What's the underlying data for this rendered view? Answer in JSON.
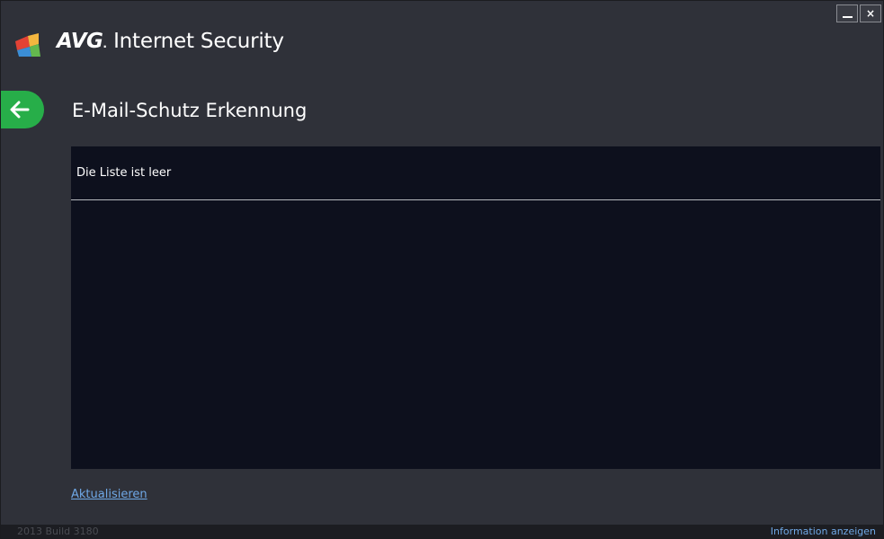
{
  "app": {
    "brand_bold": "AVG",
    "brand_dot": ".",
    "brand_rest": " Internet Security",
    "logo_colors": [
      "#e34235",
      "#f4b63f",
      "#3b8ed6",
      "#63b84e"
    ]
  },
  "window_controls": {
    "minimize_icon": "minimize-icon",
    "close_label": "×"
  },
  "header": {
    "back_icon": "arrow-left-icon",
    "title": "E-Mail-Schutz Erkennung"
  },
  "list": {
    "empty_text": "Die Liste ist leer"
  },
  "actions": {
    "refresh_label": "Aktualisieren"
  },
  "status_bar": {
    "build_text": "2013  Build 3180",
    "info_link": "Information anzeigen"
  },
  "colors": {
    "window_bg": "#2f3139",
    "panel_bg": "#0d101d",
    "accent_green": "#27ae49",
    "link_blue": "#6fa8e6"
  }
}
